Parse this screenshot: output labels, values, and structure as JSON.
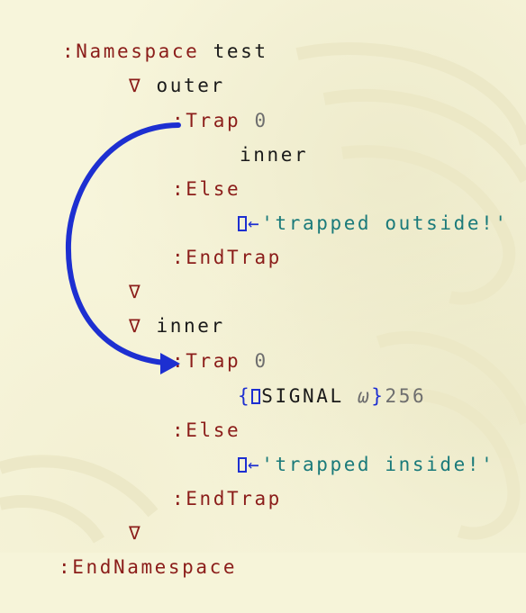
{
  "namespace": {
    "open_keyword": ":Namespace",
    "name": "test",
    "close_keyword": ":EndNamespace"
  },
  "outer_fn": {
    "del_symbol": "∇",
    "name": "outer",
    "trap_keyword": ":Trap",
    "trap_code": "0",
    "call": "inner",
    "else_keyword": ":Else",
    "assign_arrow": "←",
    "message": "'trapped outside!'",
    "endtrap_keyword": ":EndTrap",
    "close_del": "∇"
  },
  "inner_fn": {
    "del_symbol": "∇",
    "name": "inner",
    "trap_keyword": ":Trap",
    "trap_code": "0",
    "open_brace": "{",
    "signal_name": "SIGNAL",
    "omega": "ω",
    "close_brace": "}",
    "signal_value": "256",
    "else_keyword": ":Else",
    "assign_arrow": "←",
    "message": "'trapped inside!'",
    "endtrap_keyword": ":EndTrap",
    "close_del": "∇"
  },
  "colors": {
    "keyword": "#8b1d1a",
    "string": "#1a7a7a",
    "number": "#6e6e6e",
    "system": "#1d2fd1",
    "arrow": "#1d2fd1"
  },
  "icons": {
    "flow_arrow": "curved-arrow-icon"
  }
}
